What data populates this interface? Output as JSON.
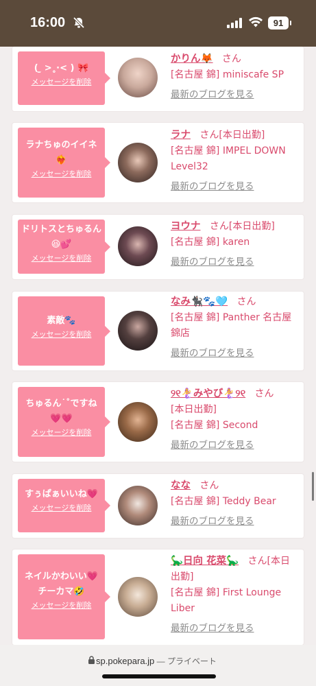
{
  "status": {
    "time": "16:00",
    "battery": "91"
  },
  "feed": {
    "delete_label": "メッセージを削除",
    "blog_label": "最新のブログを見る",
    "san": "さん",
    "cards": [
      {
        "message": "(  ̫ >˳⋅< ) 🎀",
        "name": "かりん🦊",
        "lines": [
          "[名古屋 錦] miniscafe SP"
        ],
        "after_san": "",
        "avatar_color": "#c9a99c"
      },
      {
        "message": "ラナちゅのイイネ ❤️‍🔥",
        "name": "ラナ",
        "after_san": "[本日出勤]",
        "lines": [
          "[名古屋 錦] IMPEL DOWN",
          "Level32"
        ],
        "avatar_color": "#4a3a33"
      },
      {
        "message": "ドリトスとちゅるん😆💕",
        "name": "ヨウナ",
        "after_san": "[本日出勤]",
        "lines": [
          "[名古屋 錦] karen"
        ],
        "avatar_color": "#3b2a2e"
      },
      {
        "message": "素敵🐾",
        "name": "なみ🐈‍⬛🐾🩵",
        "after_san": "",
        "lines": [
          "[名古屋 錦] Panther 名古屋",
          "錦店"
        ],
        "avatar_color": "#2d2326"
      },
      {
        "message": "ちゅるん˙˚ですね 💗💗",
        "name": "୨୧🧜‍♀️みやび🧜‍♀️୨୧",
        "after_san": "",
        "lines": [
          "[本日出勤]",
          "[名古屋 錦] Second"
        ],
        "avatar_color": "#8a5a3c"
      },
      {
        "message": "すぅぱぁいいね💗",
        "name": "なな",
        "after_san": "",
        "lines": [
          "[名古屋 錦] Teddy Bear"
        ],
        "avatar_color": "#6b5a52"
      },
      {
        "message": "ネイルかわいい💗チーカマ🤣",
        "name": "🦕日向 花菜🦕",
        "after_san": "[本日",
        "lines": [
          "出勤]",
          "[名古屋 錦] First Lounge",
          "Liber"
        ],
        "avatar_color": "#b39a83"
      }
    ]
  },
  "browser": {
    "url": "sp.pokepara.jp",
    "privacy": " — プライベート"
  },
  "colors": {
    "bubble": "#fa8ea3",
    "name": "#d94a6c",
    "status_bar": "#5b4a3a"
  }
}
